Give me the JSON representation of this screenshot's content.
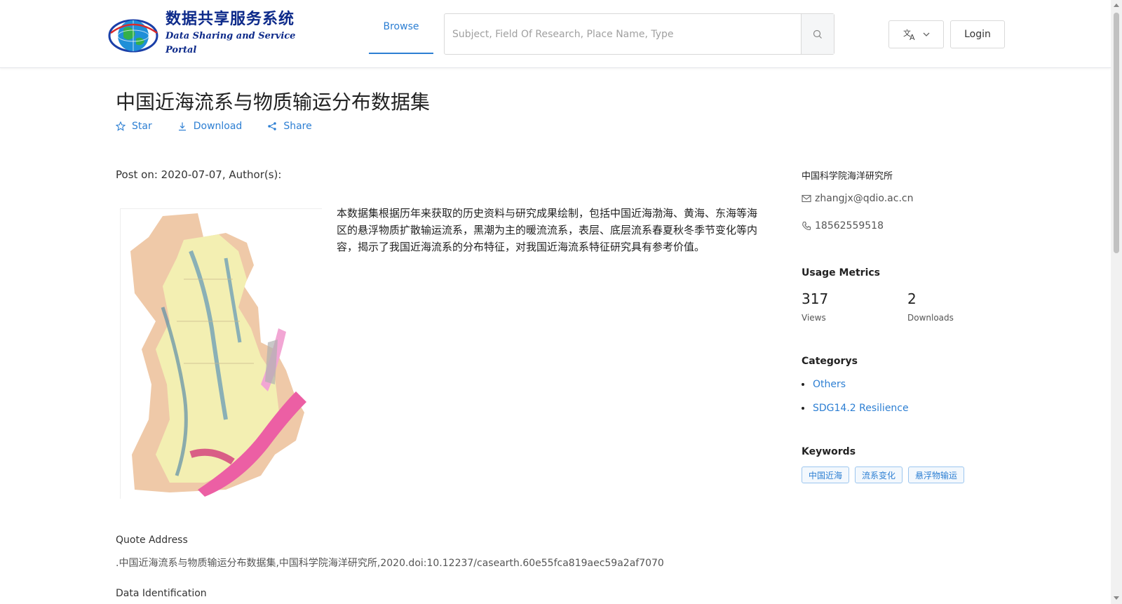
{
  "header": {
    "logo": {
      "cn_title": "数据共享服务系统",
      "en_title": "Data Sharing and Service Portal",
      "icon": "globe-logo-icon"
    },
    "nav": {
      "browse_label": "Browse"
    },
    "search": {
      "placeholder": "Subject, Field Of Research, Place Name, Type",
      "value": ""
    },
    "lang_icon": "translate-icon",
    "login_label": "Login"
  },
  "dataset": {
    "title": "中国近海流系与物质输运分布数据集",
    "actions": {
      "star": "Star",
      "download": "Download",
      "share": "Share"
    },
    "post_on": "Post on: 2020-07-07, Author(s):",
    "description": "本数据集根据历年来获取的历史资料与研究成果绘制，包括中国近海渤海、黄海、东海等海区的悬浮物质扩散输运流系，黑潮为主的暖流流系，表层、底层流系春夏秋冬季节变化等内容，揭示了我国近海流系的分布特征，对我国近海流系特征研究具有参考价值。",
    "quote": {
      "label": "Quote Address",
      "value": ".中国近海流系与物质输运分布数据集,中国科学院海洋研究所,2020.doi:10.12237/casearth.60e55fca819aec59a2af7070"
    },
    "identification_label": "Data Identification"
  },
  "sidebar": {
    "organization": "中国科学院海洋研究所",
    "email": "zhangjx@qdio.ac.cn",
    "phone": "18562559518",
    "usage": {
      "heading": "Usage Metrics",
      "views_value": "317",
      "views_label": "Views",
      "downloads_value": "2",
      "downloads_label": "Downloads"
    },
    "categories": {
      "heading": "Categorys",
      "items": [
        "Others",
        "SDG14.2 Resilience"
      ]
    },
    "keywords": {
      "heading": "Keywords",
      "items": [
        "中国近海",
        "流系变化",
        "悬浮物输运"
      ]
    }
  },
  "colors": {
    "accent": "#2d7fd3",
    "logo_blue": "#0d2a8a"
  }
}
